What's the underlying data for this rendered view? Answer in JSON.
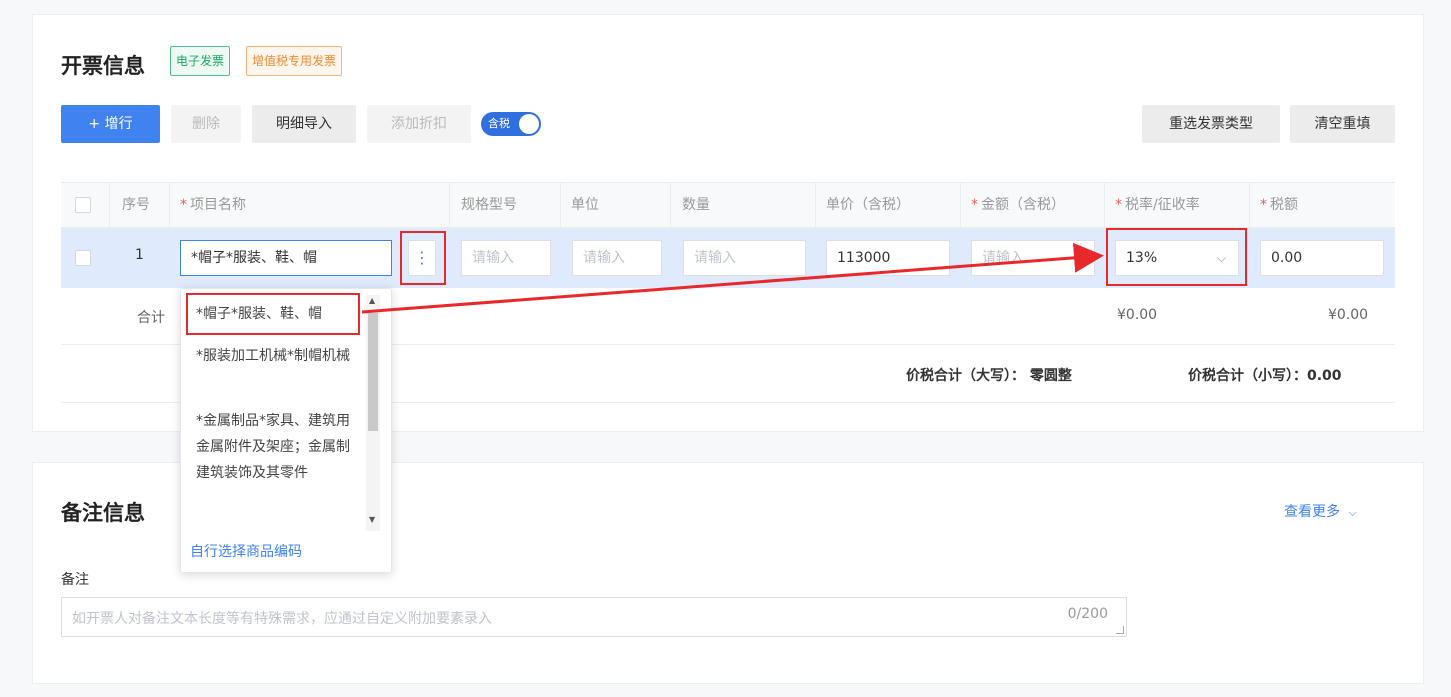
{
  "invoice": {
    "title": "开票信息",
    "tags": [
      "电子发票",
      "增值税专用发票"
    ],
    "toolbar": {
      "add_row": "+ 增行",
      "delete": "删除",
      "import_detail": "明细导入",
      "add_discount": "添加折扣",
      "tax_toggle": "含税",
      "reselect_type": "重选发票类型",
      "clear_refill": "清空重填"
    },
    "table": {
      "headers": {
        "seq": "序号",
        "item_name": "项目名称",
        "spec": "规格型号",
        "unit": "单位",
        "quantity": "数量",
        "unit_price": "单价（含税）",
        "amount": "金额（含税）",
        "tax_rate": "税率/征收率",
        "tax": "税额"
      },
      "row": {
        "seq": "1",
        "item_name": "*帽子*服装、鞋、帽",
        "spec_placeholder": "请输入",
        "unit_placeholder": "请输入",
        "quantity_placeholder": "请输入",
        "unit_price": "113000",
        "amount_placeholder": "请输入",
        "tax_rate": "13%",
        "tax": "0.00"
      },
      "sum": {
        "label": "合计",
        "amount": "¥0.00",
        "tax": "¥0.00"
      },
      "total_upper": "价税合计（大写）：  零圆整",
      "total_lower": "价税合计（小写）：0.00"
    },
    "dropdown": {
      "items": [
        "*帽子*服装、鞋、帽",
        "*服装加工机械*制帽机械",
        "*金属制品*家具、建筑用金属附件及架座；金属制建筑装饰及其零件"
      ],
      "link": "自行选择商品编码"
    }
  },
  "remarks": {
    "title": "备注信息",
    "view_more": "查看更多",
    "field_label": "备注",
    "placeholder": "如开票人对备注文本长度等有特殊需求，应通过自定义附加要素录入",
    "counter": "0/200"
  },
  "colors": {
    "primary": "#3f82f0",
    "highlight_red": "#e8292b",
    "row_selected": "#dfeafc"
  }
}
